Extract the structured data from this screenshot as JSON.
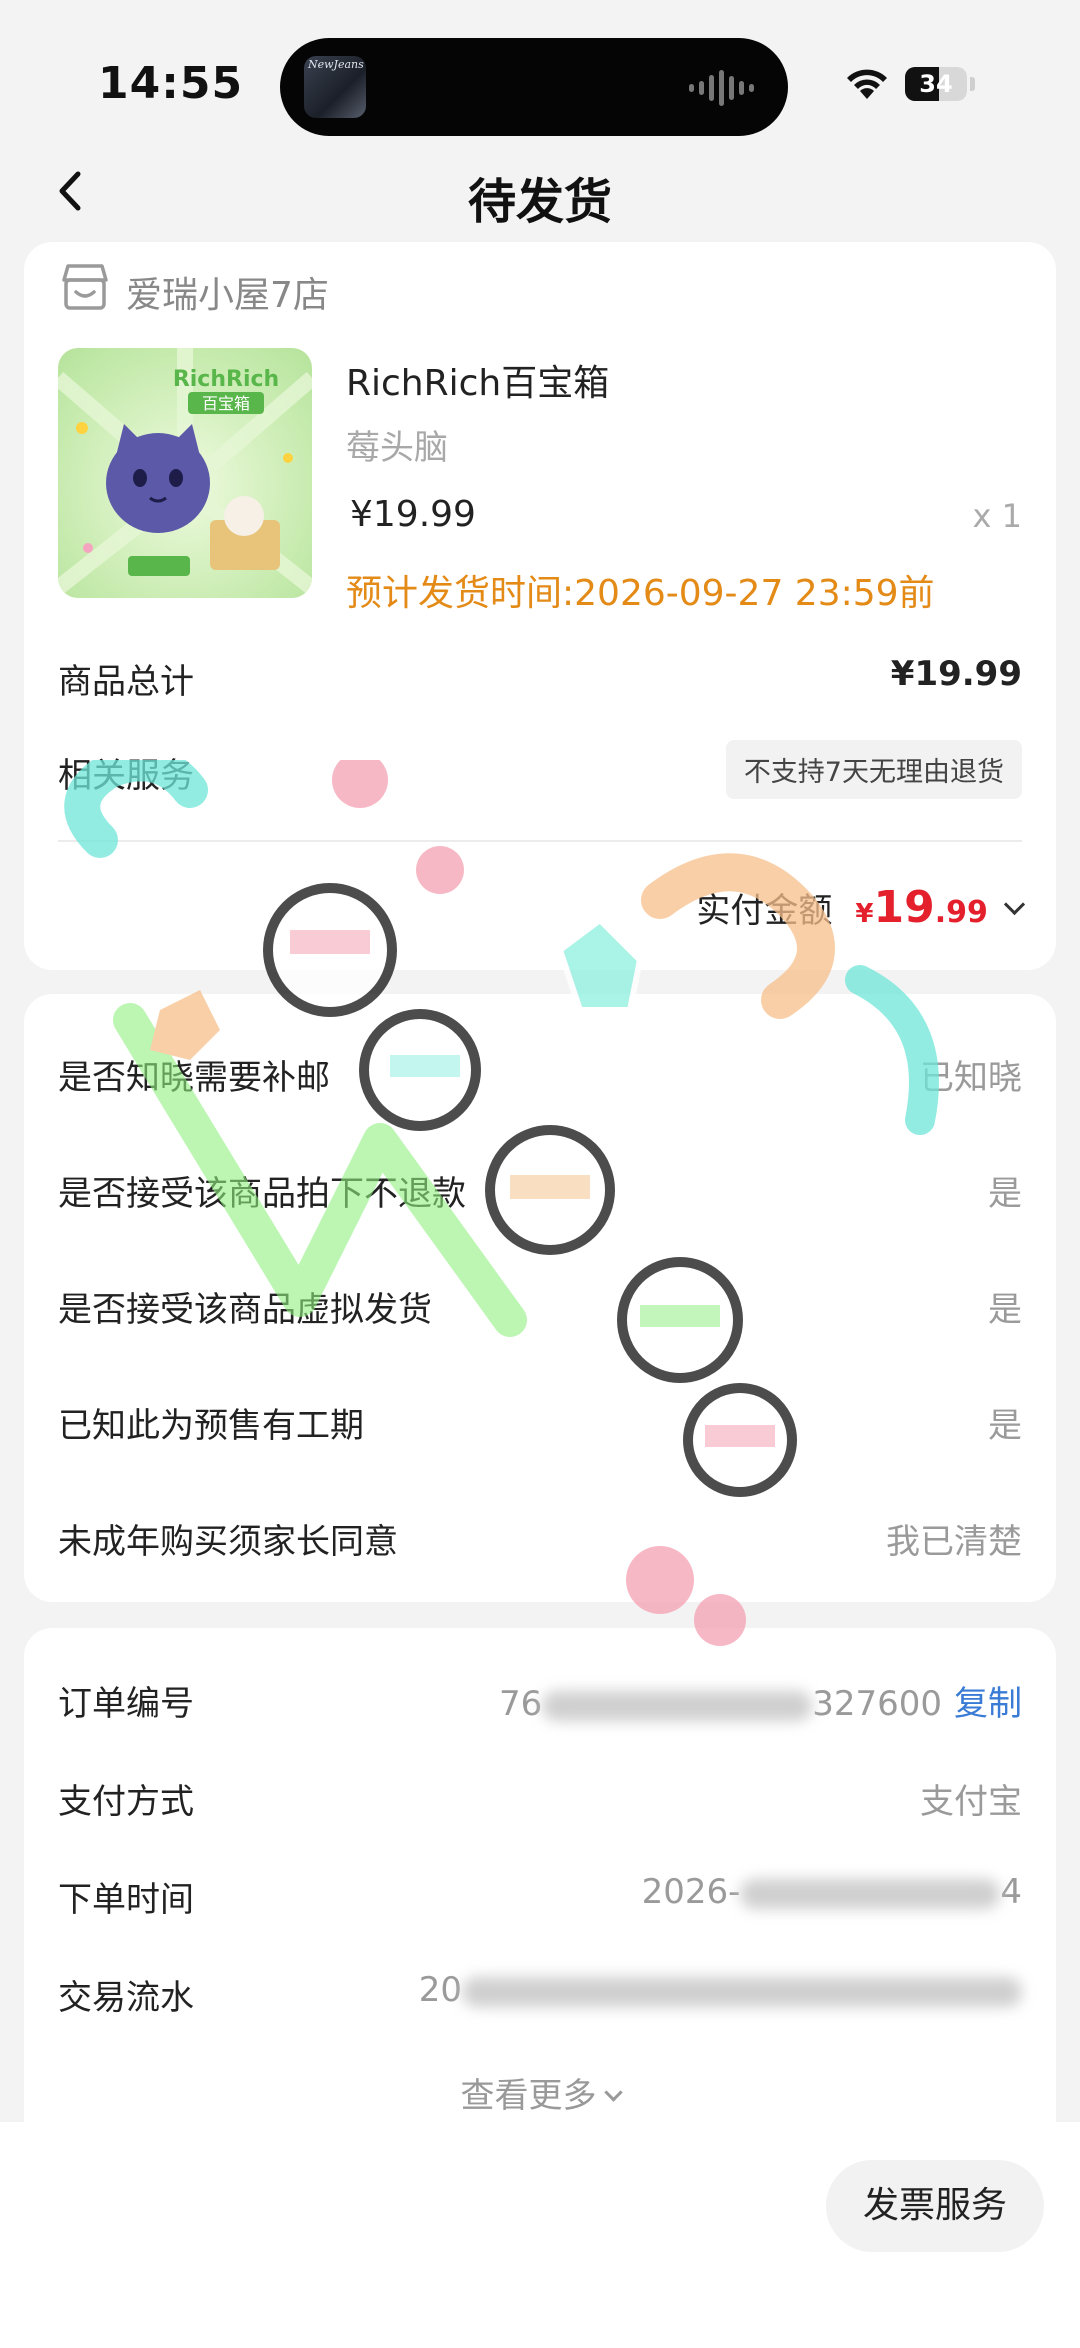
{
  "status_bar": {
    "time": "14:55",
    "battery": "34",
    "now_playing_art": "NewJeans"
  },
  "nav": {
    "title": "待发货"
  },
  "shop": {
    "name": "爱瑞小屋7店"
  },
  "product": {
    "name": "RichRich百宝箱",
    "variant": "莓头脑",
    "price": "¥19.99",
    "quantity": "x 1",
    "ship_time": "预计发货时间:2026-09-27 23:59前",
    "thumb_text": "RichRich 百宝箱"
  },
  "summary": {
    "total_label": "商品总计",
    "total_value": "¥19.99",
    "service_label": "相关服务",
    "service_tag": "不支持7天无理由退货",
    "paid_label": "实付金额",
    "paid_currency": "¥",
    "paid_int": "19",
    "paid_dec": ".99"
  },
  "confirmations": [
    {
      "label": "是否知晓需要补邮",
      "value": "已知晓"
    },
    {
      "label": "是否接受该商品拍下不退款",
      "value": "是"
    },
    {
      "label": "是否接受该商品虚拟发货",
      "value": "是"
    },
    {
      "label": "已知此为预售有工期",
      "value": "是"
    },
    {
      "label": "未成年购买须家长同意",
      "value": "我已清楚"
    }
  ],
  "order": {
    "number_label": "订单编号",
    "number_prefix": "76",
    "number_suffix": "327600",
    "copy_label": "复制",
    "payment_label": "支付方式",
    "payment_value": "支付宝",
    "time_label": "下单时间",
    "time_prefix": "2026-",
    "time_suffix": "4",
    "txn_label": "交易流水",
    "txn_prefix": "20",
    "more_label": "查看更多"
  },
  "bottom": {
    "invoice_label": "发票服务"
  },
  "colors": {
    "accent_orange": "#e38a17",
    "price_red": "#e4202d",
    "link_blue": "#3a7bd5"
  }
}
